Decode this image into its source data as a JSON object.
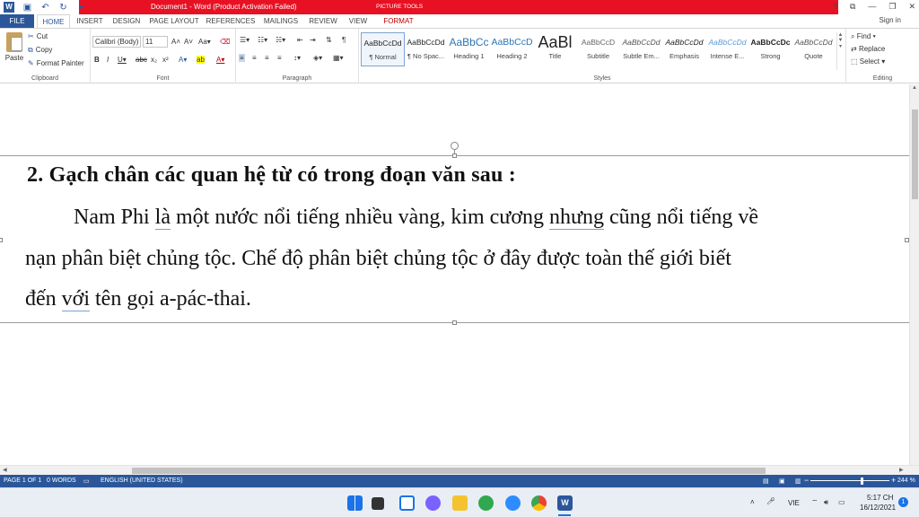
{
  "window": {
    "title": "Document1 - Word (Product Activation Failed)",
    "context_tab_group": "PICTURE TOOLS",
    "controls": [
      "?",
      "⧉",
      "—",
      "❐",
      "✕"
    ]
  },
  "tabs": [
    "FILE",
    "HOME",
    "INSERT",
    "DESIGN",
    "PAGE LAYOUT",
    "REFERENCES",
    "MAILINGS",
    "REVIEW",
    "VIEW",
    "FORMAT"
  ],
  "sign_in": "Sign in",
  "clipboard": {
    "paste": "Paste",
    "cut": "Cut",
    "copy": "Copy",
    "format_painter": "Format Painter",
    "label": "Clipboard"
  },
  "font": {
    "name": "Calibri (Body)",
    "size": "11",
    "label": "Font"
  },
  "paragraph": {
    "label": "Paragraph"
  },
  "styles": {
    "label": "Styles",
    "items": [
      {
        "preview": "AaBbCcDd",
        "name": "¶ Normal"
      },
      {
        "preview": "AaBbCcDd",
        "name": "¶ No Spac..."
      },
      {
        "preview": "AaBbCc",
        "name": "Heading 1"
      },
      {
        "preview": "AaBbCcD",
        "name": "Heading 2"
      },
      {
        "preview": "AaBl",
        "name": "Title"
      },
      {
        "preview": "AaBbCcD",
        "name": "Subtitle"
      },
      {
        "preview": "AaBbCcDd",
        "name": "Subtle Em..."
      },
      {
        "preview": "AaBbCcDd",
        "name": "Emphasis"
      },
      {
        "preview": "AaBbCcDd",
        "name": "Intense E..."
      },
      {
        "preview": "AaBbCcDc",
        "name": "Strong"
      },
      {
        "preview": "AaBbCcDd",
        "name": "Quote"
      }
    ]
  },
  "editing": {
    "find": "Find",
    "replace": "Replace",
    "select": "Select",
    "label": "Editing"
  },
  "document": {
    "heading": "2. Gạch chân các quan hệ từ có trong đoạn văn sau :",
    "line1": {
      "a": "Nam Phi ",
      "u1": "là",
      "b": " một nước nổi tiếng nhiều vàng, kim cương ",
      "u2": "nhưng",
      "c": " cũng nổi tiếng về"
    },
    "line2": "nạn phân biệt chủng tộc. Chế độ phân biệt chủng tộc ở đây được toàn thế giới biết",
    "line3": {
      "a": "đến ",
      "u1": "với",
      "b": " tên gọi a-pác-thai."
    }
  },
  "status": {
    "page": "PAGE 1 OF 1",
    "words": "0 WORDS",
    "language": "ENGLISH (UNITED STATES)",
    "zoom": "244 %",
    "zoom_level": 244
  },
  "taskbar": {
    "lang": "VIE",
    "time": "5:17 CH",
    "date": "16/12/2021",
    "notifications": "1"
  }
}
